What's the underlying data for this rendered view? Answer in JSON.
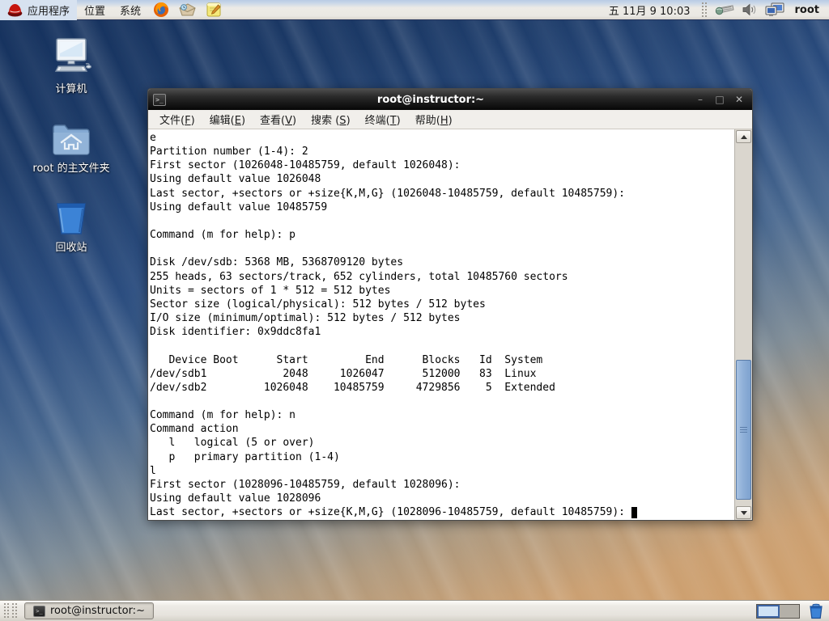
{
  "icons": {
    "terminal_glyph": ">_",
    "window_minimize": "–",
    "window_maximize": "□",
    "window_close": "✕"
  },
  "top_panel": {
    "menus": [
      {
        "label": "应用程序"
      },
      {
        "label": "位置"
      },
      {
        "label": "系统"
      }
    ],
    "clock": "五 11月  9 10:03",
    "username": "root"
  },
  "desktop_icons": [
    {
      "label": "计算机"
    },
    {
      "label": "root 的主文件夹"
    },
    {
      "label": "回收站"
    }
  ],
  "terminal_window": {
    "title": "root@instructor:~",
    "menu": [
      {
        "pre": "文件(",
        "key": "F",
        "post": ")"
      },
      {
        "pre": "编辑(",
        "key": "E",
        "post": ")"
      },
      {
        "pre": "查看(",
        "key": "V",
        "post": ")"
      },
      {
        "pre": "搜索 (",
        "key": "S",
        "post": ")"
      },
      {
        "pre": "终端(",
        "key": "T",
        "post": ")"
      },
      {
        "pre": "帮助(",
        "key": "H",
        "post": ")"
      }
    ],
    "output": "e\nPartition number (1-4): 2\nFirst sector (1026048-10485759, default 1026048):\nUsing default value 1026048\nLast sector, +sectors or +size{K,M,G} (1026048-10485759, default 10485759):\nUsing default value 10485759\n\nCommand (m for help): p\n\nDisk /dev/sdb: 5368 MB, 5368709120 bytes\n255 heads, 63 sectors/track, 652 cylinders, total 10485760 sectors\nUnits = sectors of 1 * 512 = 512 bytes\nSector size (logical/physical): 512 bytes / 512 bytes\nI/O size (minimum/optimal): 512 bytes / 512 bytes\nDisk identifier: 0x9ddc8fa1\n\n   Device Boot      Start         End      Blocks   Id  System\n/dev/sdb1            2048     1026047      512000   83  Linux\n/dev/sdb2         1026048    10485759     4729856    5  Extended\n\nCommand (m for help): n\nCommand action\n   l   logical (5 or over)\n   p   primary partition (1-4)\nl\nFirst sector (1028096-10485759, default 1028096):\nUsing default value 1028096\nLast sector, +sectors or +size{K,M,G} (1028096-10485759, default 10485759): "
  },
  "taskbar": {
    "task_label": "root@instructor:~"
  },
  "colors": {
    "wallpaper_top": "#1c3a67",
    "wallpaper_bottom_left": "#d2a06a",
    "titlebar_bg": "#1e1e1e",
    "panel_bg": "#ebe9e4",
    "terminal_bg": "#ffffff",
    "terminal_fg": "#000000",
    "workspace_active_fill": "#cfe2f5",
    "scrollbar_thumb": "#8fb0d8"
  }
}
